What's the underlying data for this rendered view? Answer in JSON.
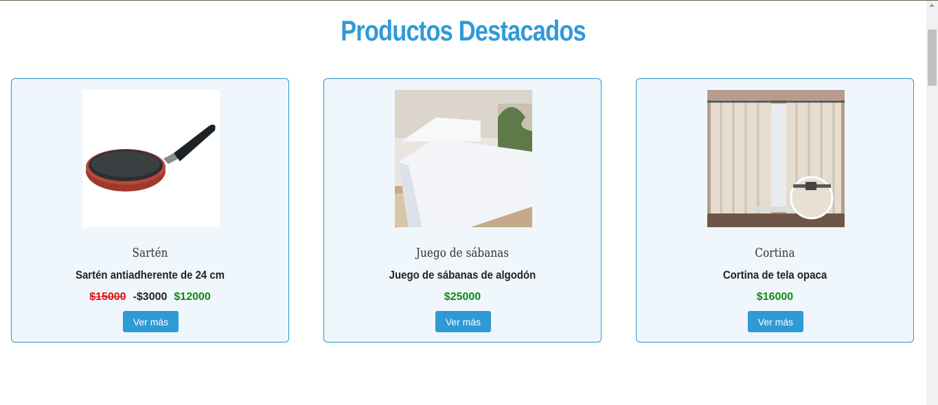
{
  "header": {
    "title": "Productos Destacados"
  },
  "products": [
    {
      "name": "Sartén",
      "description": "Sartén antiadherente de 24 cm",
      "old_price": "$15000",
      "discount": "-$3000",
      "price": "$12000",
      "button_label": "Ver más"
    },
    {
      "name": "Juego de sábanas",
      "description": "Juego de sábanas de algodón",
      "price": "$25000",
      "button_label": "Ver más"
    },
    {
      "name": "Cortina",
      "description": "Cortina de tela opaca",
      "price": "$16000",
      "button_label": "Ver más"
    }
  ],
  "colors": {
    "accent": "#2f9ad8",
    "card_background": "#eff6fc",
    "card_border": "#2a97c4",
    "old_price": "#e01010",
    "price": "#0f8a0f"
  }
}
